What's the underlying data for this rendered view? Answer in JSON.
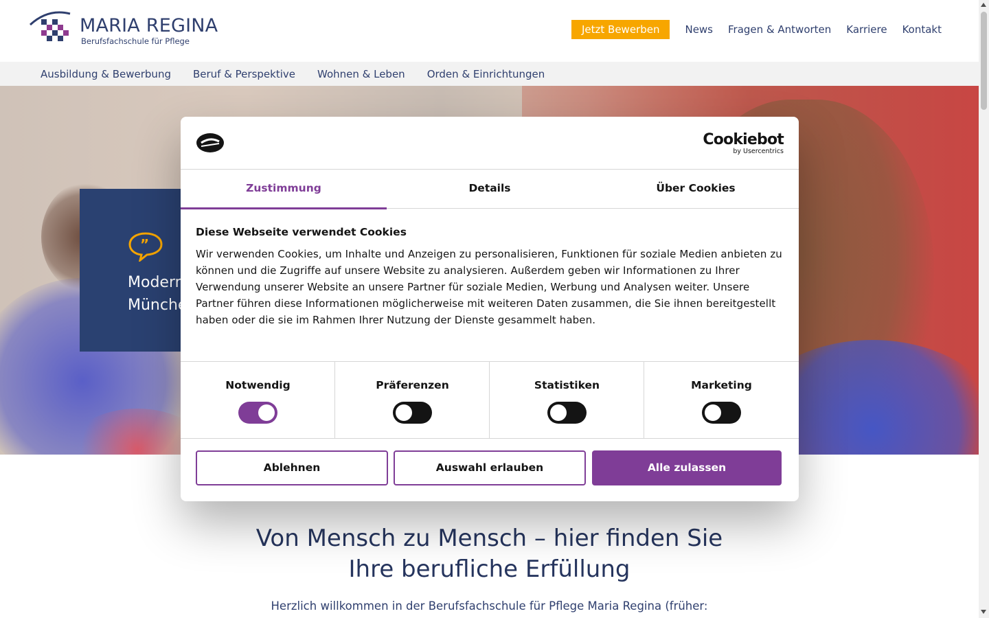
{
  "header": {
    "logo_title": "MARIA REGINA",
    "logo_subtitle": "Berufsfachschule für Pflege",
    "apply_button": "Jetzt Bewerben",
    "links": [
      "News",
      "Fragen & Antworten",
      "Karriere",
      "Kontakt"
    ]
  },
  "subnav": {
    "items": [
      "Ausbildung & Bewerbung",
      "Beruf & Perspektive",
      "Wohnen & Leben",
      "Orden & Einrichtungen"
    ]
  },
  "hero": {
    "quote_line1": "Moderne",
    "quote_line2": "Münche"
  },
  "cookie_dialog": {
    "brand": "Cookiebot",
    "brand_sub": "by Usercentrics",
    "tabs": [
      "Zustimmung",
      "Details",
      "Über Cookies"
    ],
    "active_tab": "Zustimmung",
    "heading": "Diese Webseite verwendet Cookies",
    "body": "Wir verwenden Cookies, um Inhalte und Anzeigen zu personalisieren, Funktionen für soziale Medien anbieten zu können und die Zugriffe auf unsere Website zu analysieren. Außerdem geben wir Informationen zu Ihrer Verwendung unserer Website an unsere Partner für soziale Medien, Werbung und Analysen weiter. Unsere Partner führen diese Informationen möglicherweise mit weiteren Daten zusammen, die Sie ihnen bereitgestellt haben oder die sie im Rahmen Ihrer Nutzung der Dienste gesammelt haben.",
    "toggles": [
      {
        "label": "Notwendig",
        "on": true
      },
      {
        "label": "Präferenzen",
        "on": false
      },
      {
        "label": "Statistiken",
        "on": false
      },
      {
        "label": "Marketing",
        "on": false
      }
    ],
    "buttons": {
      "reject": "Ablehnen",
      "allow_selection": "Auswahl erlauben",
      "allow_all": "Alle zulassen"
    }
  },
  "main": {
    "headline_line1": "Von Mensch zu Mensch – hier finden Sie",
    "headline_line2": "Ihre berufliche Erfüllung",
    "intro": "Herzlich willkommen in der Berufsfachschule für Pflege Maria Regina (früher:"
  },
  "colors": {
    "brand_navy": "#2a4171",
    "accent_orange": "#f7a600",
    "cookiebot_purple": "#7f3d97"
  }
}
